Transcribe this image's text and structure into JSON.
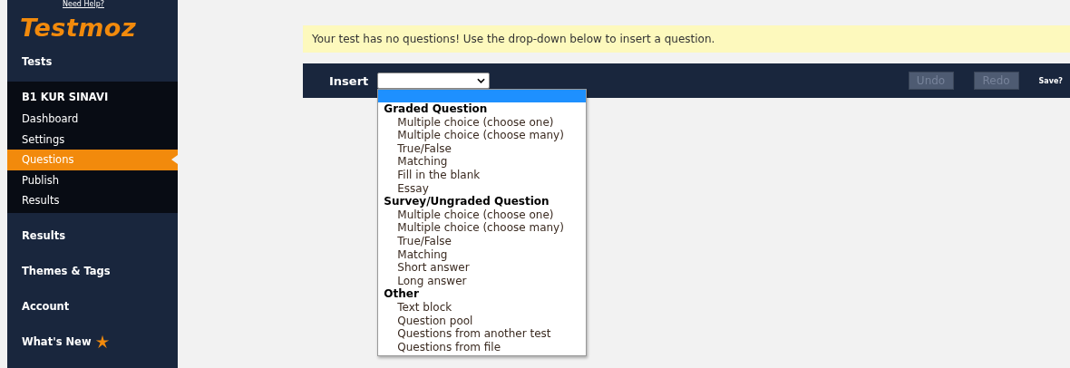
{
  "sidebar": {
    "help_link": "Need Help?",
    "logo": "Testmoz",
    "top_items": [
      {
        "label": "Tests"
      }
    ],
    "test_section": {
      "title": "B1 KUR SINAVI",
      "items": [
        {
          "label": "Dashboard",
          "selected": false
        },
        {
          "label": "Settings",
          "selected": false
        },
        {
          "label": "Questions",
          "selected": true
        },
        {
          "label": "Publish",
          "selected": false
        },
        {
          "label": "Results",
          "selected": false
        }
      ]
    },
    "bottom_items": [
      {
        "label": "Results",
        "kind": "plain"
      },
      {
        "label": "Themes & Tags",
        "kind": "plain"
      },
      {
        "label": "Account",
        "kind": "plain"
      },
      {
        "label": "What's New",
        "kind": "new"
      }
    ]
  },
  "notice": "Your test has no questions! Use the drop-down below to insert a question.",
  "toolbar": {
    "insert_label": "Insert",
    "undo": {
      "label": "Undo",
      "disabled": true
    },
    "redo": {
      "label": "Redo",
      "disabled": true
    },
    "save": "Save?"
  },
  "dropdown": {
    "blank_highlighted": true,
    "groups": [
      {
        "label": "Graded Question",
        "options": [
          "Multiple choice (choose one)",
          "Multiple choice (choose many)",
          "True/False",
          "Matching",
          "Fill in the blank",
          "Essay"
        ]
      },
      {
        "label": "Survey/Ungraded Question",
        "options": [
          "Multiple choice (choose one)",
          "Multiple choice (choose many)",
          "True/False",
          "Matching",
          "Short answer",
          "Long answer"
        ]
      },
      {
        "label": "Other",
        "options": [
          "Text block",
          "Question pool",
          "Questions from another test",
          "Questions from file"
        ]
      }
    ]
  }
}
